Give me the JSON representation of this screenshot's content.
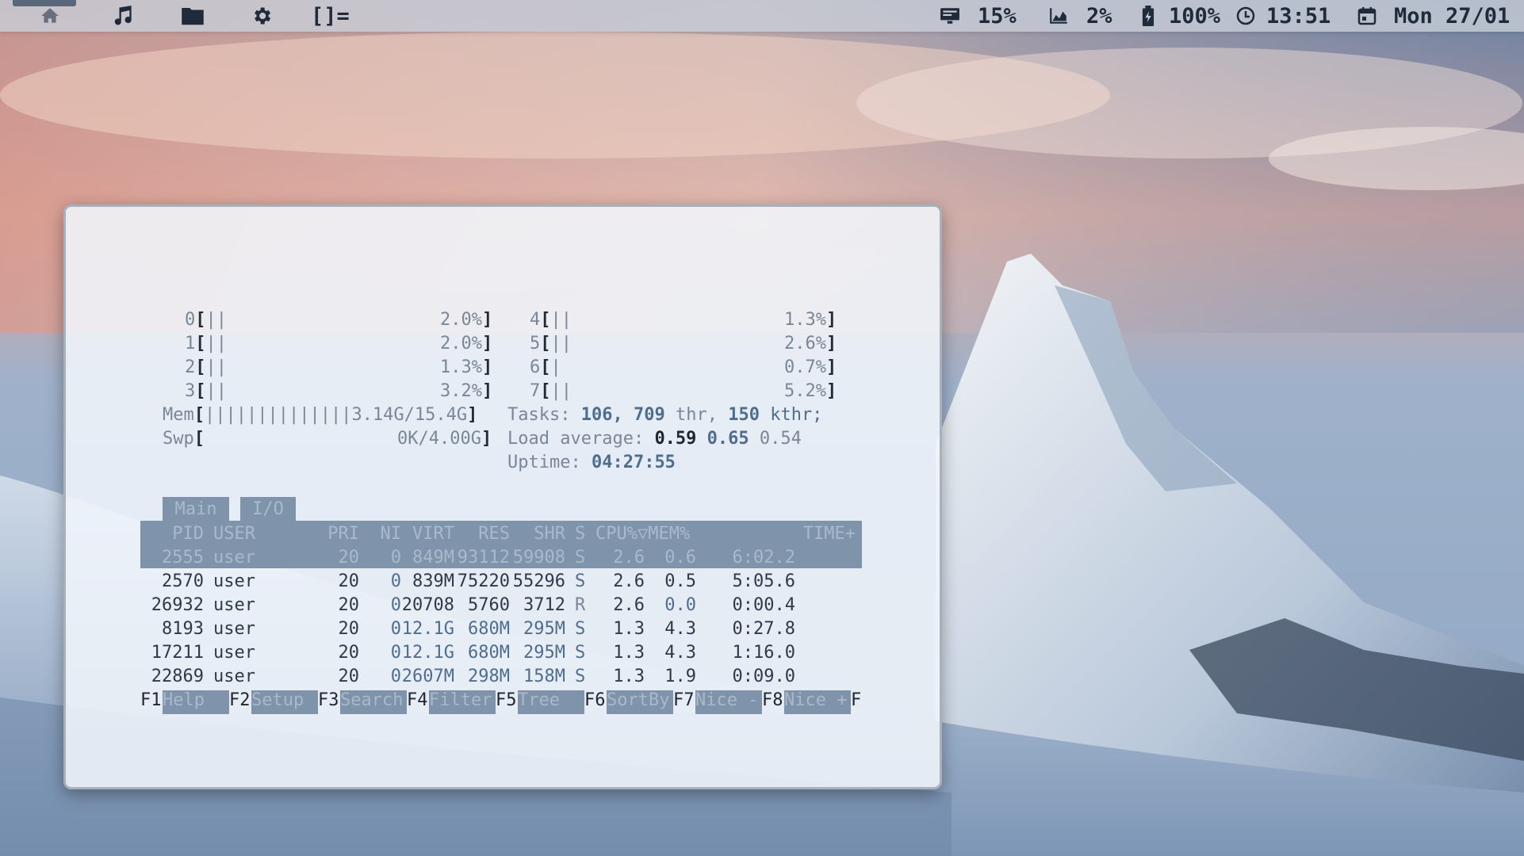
{
  "topbar": {
    "workspaces": [
      {
        "icon": "home-icon",
        "active": true
      },
      {
        "icon": "music-note-icon",
        "active": false
      },
      {
        "icon": "folder-icon",
        "active": false
      },
      {
        "icon": "gear-icon",
        "active": false
      }
    ],
    "layout_indicator": "[]=",
    "status": {
      "cpu_icon": "monitor-icon",
      "cpu": "15%",
      "mem_icon": "area-chart-icon",
      "mem": "2%",
      "battery_icon": "battery-icon",
      "battery": "100%",
      "clock_icon": "clock-icon",
      "time": "13:51",
      "calendar_icon": "calendar-icon",
      "date": "Mon 27/01"
    },
    "text_color": "#1f2a3a"
  },
  "htop": {
    "cpus": [
      {
        "id": "0",
        "bars": "||",
        "pct": "2.0%"
      },
      {
        "id": "1",
        "bars": "||",
        "pct": "2.0%"
      },
      {
        "id": "2",
        "bars": "||",
        "pct": "1.3%"
      },
      {
        "id": "3",
        "bars": "||",
        "pct": "3.2%"
      },
      {
        "id": "4",
        "bars": "||",
        "pct": "1.3%"
      },
      {
        "id": "5",
        "bars": "||",
        "pct": "2.6%"
      },
      {
        "id": "6",
        "bars": "|",
        "pct": "0.7%"
      },
      {
        "id": "7",
        "bars": "||",
        "pct": "5.2%"
      }
    ],
    "mem": {
      "label": "Mem",
      "bars": "||||||||||||||",
      "value": "3.14G/15.4G"
    },
    "swp": {
      "label": "Swp",
      "value": "0K/4.00G"
    },
    "tasks": {
      "label": "Tasks:",
      "count": "106,",
      "threads": "709",
      "thr_label": "thr,",
      "kthreads": "150",
      "kthr_label": "kthr;"
    },
    "load": {
      "label": "Load average:",
      "one": "0.59",
      "five": "0.65",
      "fifteen": "0.54"
    },
    "uptime": {
      "label": "Uptime:",
      "value": "04:27:55"
    },
    "tabs": [
      "Main",
      "I/O"
    ],
    "columns": [
      "PID",
      "USER",
      "PRI",
      "NI",
      "VIRT",
      "RES",
      "SHR",
      "S",
      "CPU%▽MEM%",
      "TIME+"
    ],
    "rows": [
      {
        "pid": "2555",
        "user": "user",
        "pri": "20",
        "ni": "0",
        "virt": "849M",
        "res": "93112",
        "shr": "59908",
        "s": "S",
        "cpu": "2.6",
        "mem": "0.6",
        "time": "6:02.2",
        "selected": true
      },
      {
        "pid": "2570",
        "user": "user",
        "pri": "20",
        "ni": "0",
        "virt": "839M",
        "res": "75220",
        "shr": "55296",
        "s": "S",
        "cpu": "2.6",
        "mem": "0.5",
        "time": "5:05.6",
        "selected": false
      },
      {
        "pid": "26932",
        "user": "user",
        "pri": "20",
        "ni": "0",
        "virt": "20708",
        "res": "5760",
        "shr": "3712",
        "s": "R",
        "cpu": "2.6",
        "mem": "0.0",
        "time": "0:00.4",
        "selected": false
      },
      {
        "pid": "8193",
        "user": "user",
        "pri": "20",
        "ni": "0",
        "virt": "12.1G",
        "res": "680M",
        "shr": "295M",
        "s": "S",
        "cpu": "1.3",
        "mem": "4.3",
        "time": "0:27.8",
        "selected": false
      },
      {
        "pid": "17211",
        "user": "user",
        "pri": "20",
        "ni": "0",
        "virt": "12.1G",
        "res": "680M",
        "shr": "295M",
        "s": "S",
        "cpu": "1.3",
        "mem": "4.3",
        "time": "1:16.0",
        "selected": false
      },
      {
        "pid": "22869",
        "user": "user",
        "pri": "20",
        "ni": "0",
        "virt": "2607M",
        "res": "298M",
        "shr": "158M",
        "s": "S",
        "cpu": "1.3",
        "mem": "1.9",
        "time": "0:09.0",
        "selected": false
      }
    ],
    "fkeys": [
      {
        "key": "F1",
        "label": "Help"
      },
      {
        "key": "F2",
        "label": "Setup"
      },
      {
        "key": "F3",
        "label": "Search"
      },
      {
        "key": "F4",
        "label": "Filter"
      },
      {
        "key": "F5",
        "label": "Tree"
      },
      {
        "key": "F6",
        "label": "SortBy"
      },
      {
        "key": "F7",
        "label": "Nice -"
      },
      {
        "key": "F8",
        "label": "Nice +"
      },
      {
        "key": "F",
        "label": ""
      }
    ],
    "header_bg": "#7f94ab"
  }
}
